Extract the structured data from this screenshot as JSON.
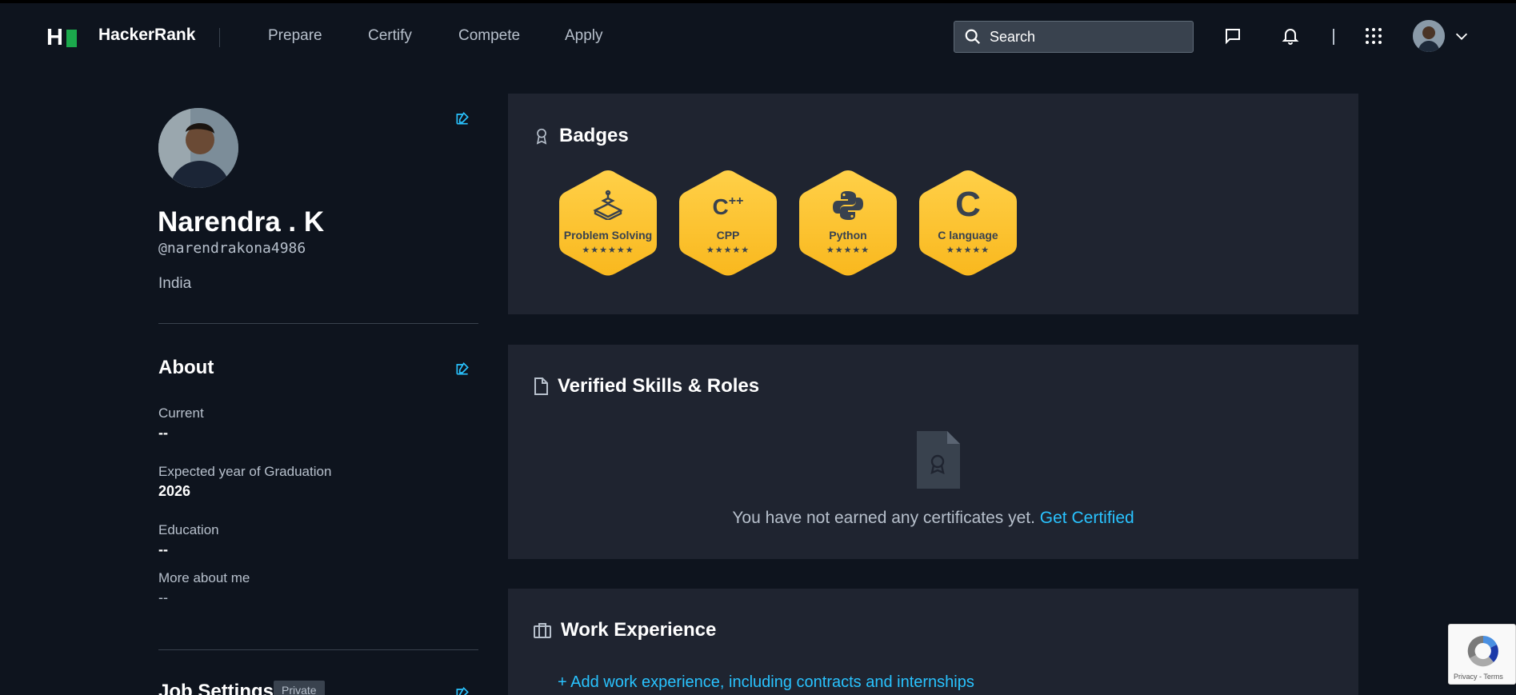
{
  "header": {
    "brand": "HackerRank",
    "logo_letter": "H",
    "nav": [
      "Prepare",
      "Certify",
      "Compete",
      "Apply"
    ],
    "search_placeholder": "Search"
  },
  "profile": {
    "name": "Narendra . K",
    "handle": "@narendrakona4986",
    "country": "India"
  },
  "about": {
    "title": "About",
    "fields": [
      {
        "label": "Current",
        "value": "--"
      },
      {
        "label": "Expected year of Graduation",
        "value": "2026"
      },
      {
        "label": "Education",
        "value": "--"
      },
      {
        "label": "More about me",
        "value": "--"
      }
    ]
  },
  "job_settings": {
    "title": "Job Settings",
    "tag": "Private"
  },
  "badges": {
    "title": "Badges",
    "items": [
      {
        "label": "Problem Solving",
        "stars": "★★★★★★",
        "icon": "problem-solving-icon"
      },
      {
        "label": "CPP",
        "stars": "★★★★★",
        "icon": "cpp-icon"
      },
      {
        "label": "Python",
        "stars": "★★★★★",
        "icon": "python-icon"
      },
      {
        "label": "C language",
        "stars": "★★★★★",
        "icon": "c-language-icon"
      }
    ]
  },
  "verified": {
    "title": "Verified Skills & Roles",
    "empty_text": "You have not earned any certificates yet.",
    "cta": "Get Certified"
  },
  "work": {
    "title": "Work Experience",
    "add_link": "+ Add work experience, including contracts and internships"
  },
  "recaptcha": {
    "text": "Privacy - Terms"
  },
  "colors": {
    "background": "#0e141e",
    "card": "#1f2430",
    "accent_link": "#29c3ff",
    "badge_gold": "#ffc334",
    "brand_green": "#1ba94c"
  }
}
